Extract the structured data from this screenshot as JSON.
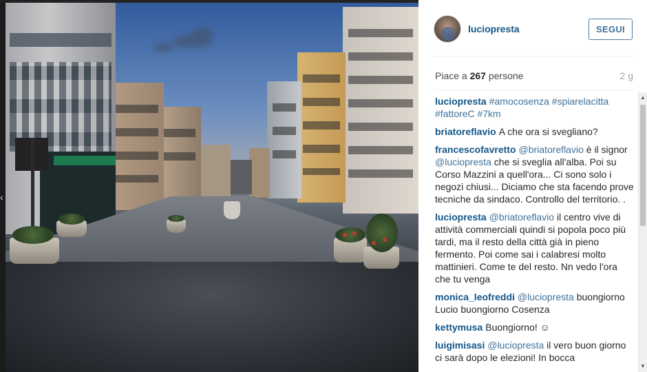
{
  "post": {
    "username": "luciopresta",
    "follow_label": "SEGUI",
    "likes_prefix": "Piace a ",
    "likes_count": "267",
    "likes_suffix": " persone",
    "age": "2 g"
  },
  "comments": [
    {
      "author": "luciopresta",
      "parts": [
        {
          "type": "tag",
          "text": "#amocosenza"
        },
        {
          "type": "text",
          "text": " "
        },
        {
          "type": "tag",
          "text": "#spiarelacitta"
        },
        {
          "type": "text",
          "text": " "
        },
        {
          "type": "tag",
          "text": "#fattoreC"
        },
        {
          "type": "text",
          "text": " "
        },
        {
          "type": "tag",
          "text": "#7km"
        }
      ]
    },
    {
      "author": "briatoreflavio",
      "parts": [
        {
          "type": "text",
          "text": "A che ora si svegliano?"
        }
      ]
    },
    {
      "author": "francescofavretto",
      "parts": [
        {
          "type": "mention",
          "text": "@briatoreflavio"
        },
        {
          "type": "text",
          "text": " è il signor "
        },
        {
          "type": "mention",
          "text": "@luciopresta"
        },
        {
          "type": "text",
          "text": " che si sveglia all'alba. Poi su Corso Mazzini a quell'ora... Ci sono solo i negozi chiusi... Diciamo che sta facendo prove tecniche da sindaco. Controllo del territorio. ."
        }
      ]
    },
    {
      "author": "luciopresta",
      "parts": [
        {
          "type": "mention",
          "text": "@briatoreflavio"
        },
        {
          "type": "text",
          "text": " il centro vive di attività commerciali quindi si popola poco più tardi, ma il resto della città già in pieno fermento. Poi come sai i calabresi molto mattinieri. Come te del resto. Nn vedo l'ora che tu venga"
        }
      ]
    },
    {
      "author": "monica_leofreddi",
      "parts": [
        {
          "type": "mention",
          "text": "@luciopresta"
        },
        {
          "type": "text",
          "text": " buongiorno Lucio buongiorno Cosenza"
        }
      ]
    },
    {
      "author": "kettymusa",
      "parts": [
        {
          "type": "text",
          "text": "Buongiorno! ☺"
        }
      ]
    },
    {
      "author": "luigimisasi",
      "parts": [
        {
          "type": "mention",
          "text": "@luciopresta"
        },
        {
          "type": "text",
          "text": " il vero buon giorno ci sarà dopo le elezioni! In bocca"
        }
      ]
    }
  ],
  "icons": {
    "scroll_up": "scroll-up-arrow-icon",
    "scroll_down": "scroll-down-arrow-icon",
    "prev": "previous-arrow-icon"
  },
  "colors": {
    "link": "#125688",
    "tag": "#3f729b",
    "muted": "#a5a7aa"
  }
}
